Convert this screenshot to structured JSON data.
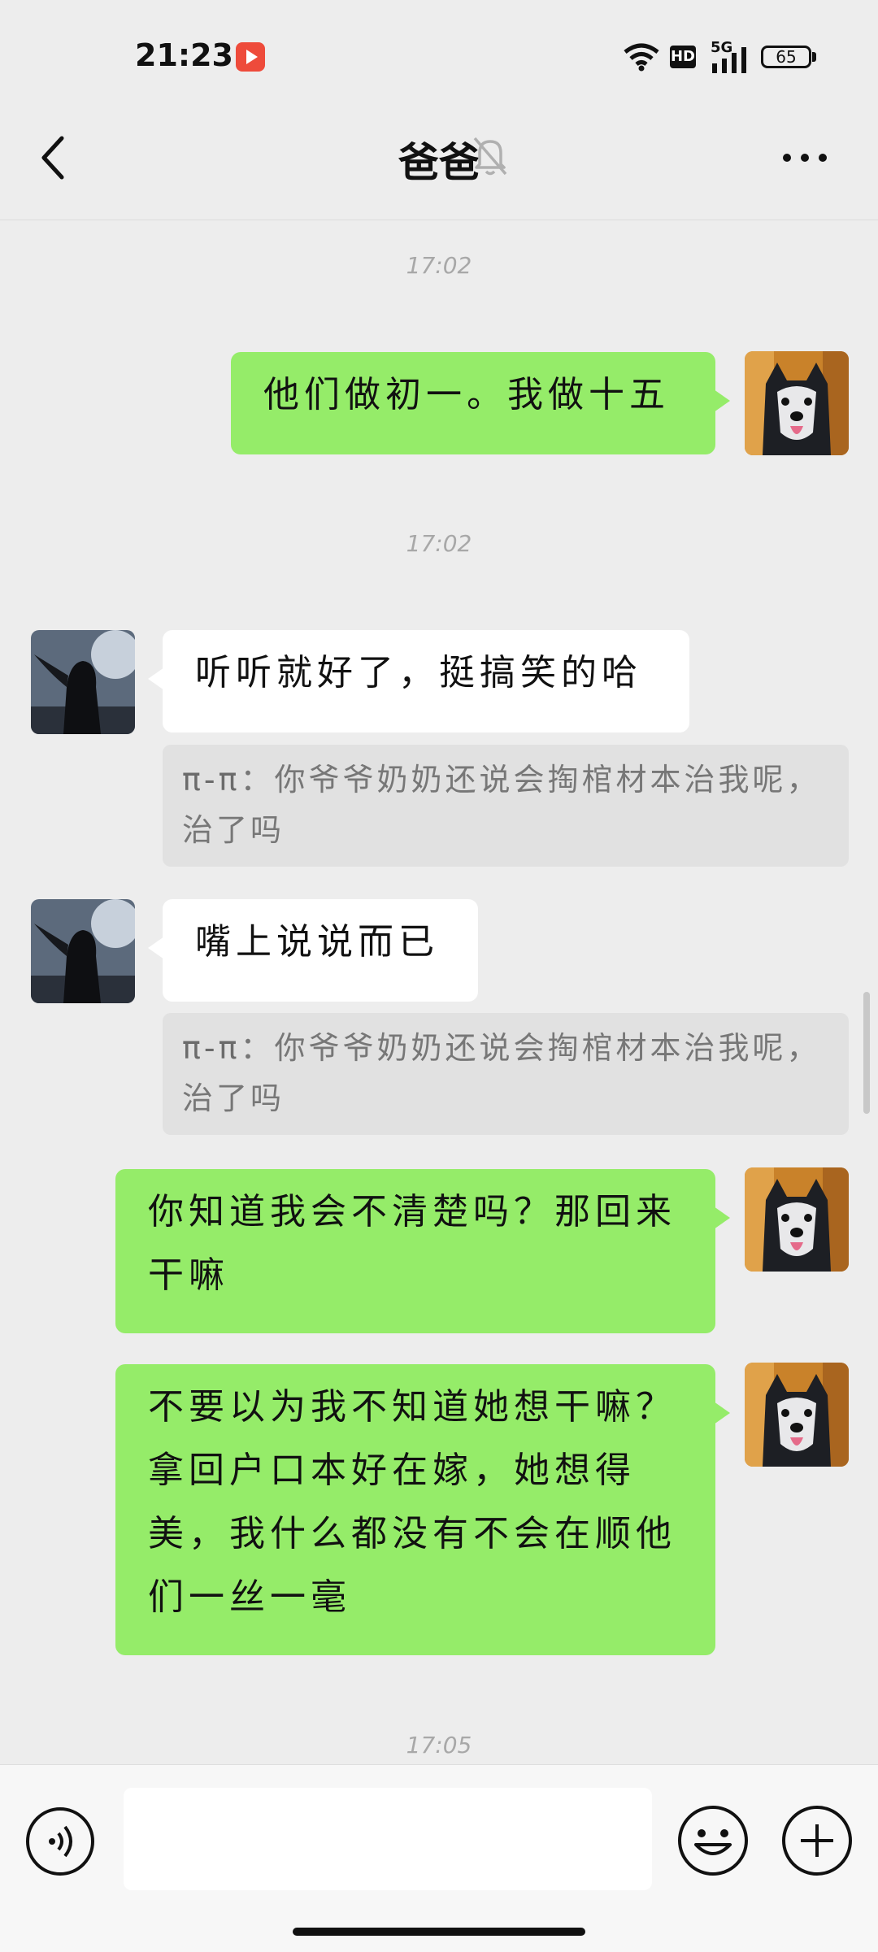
{
  "status_bar": {
    "time": "21:23",
    "network": "5G",
    "hd_label": "HD",
    "battery": "65",
    "icons": [
      "record-app-icon",
      "wifi-icon",
      "hd-icon",
      "signal-icon",
      "battery-icon"
    ]
  },
  "header": {
    "title": "爸爸",
    "back_icon": "chevron-left-icon",
    "mute_icon": "bell-off-icon",
    "more_icon": "more-dots-icon"
  },
  "messages": {
    "ts1": "17:02",
    "m1": "他们做初一。我做十五",
    "ts2": "17:02",
    "m2": "听听就好了，挺搞笑的哈",
    "q2_name": "π-π",
    "q2_text": "：你爷爷奶奶还说会掏棺材本治我呢，治了吗",
    "m3": "嘴上说说而已",
    "q3_name": "π-π",
    "q3_text": "：你爷爷奶奶还说会掏棺材本治我呢，治了吗",
    "m4": "你知道我会不清楚吗？那回来干嘛",
    "m5": "不要以为我不知道她想干嘛？拿回户口本好在嫁，她想得美，我什么都没有不会在顺他们一丝一毫",
    "ts3": "17:05"
  },
  "input_bar": {
    "placeholder": "",
    "icons": [
      "voice-icon",
      "emoji-icon",
      "plus-icon"
    ]
  },
  "colors": {
    "my_bubble": "#95ec69",
    "their_bubble": "#ffffff",
    "background": "#ededed"
  }
}
